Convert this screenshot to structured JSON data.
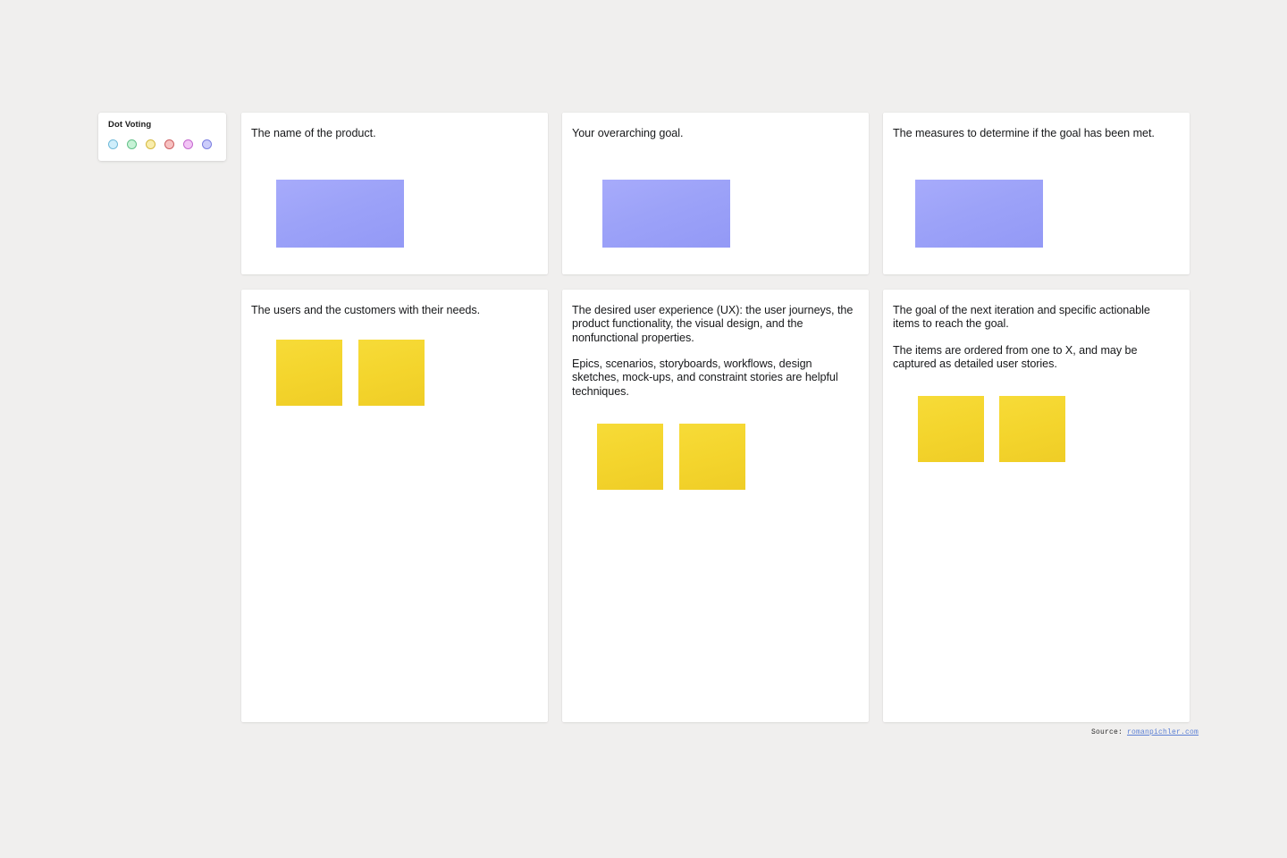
{
  "dot_voting": {
    "title": "Dot Voting",
    "dots": [
      {
        "name": "dot-blue",
        "fill": "#cfeefb",
        "border": "#6fb9d8"
      },
      {
        "name": "dot-green",
        "fill": "#c7f2d6",
        "border": "#63c189"
      },
      {
        "name": "dot-yellow",
        "fill": "#f9edac",
        "border": "#d4b93f"
      },
      {
        "name": "dot-red",
        "fill": "#f7c1c1",
        "border": "#cd5f61"
      },
      {
        "name": "dot-pink",
        "fill": "#f2c4f5",
        "border": "#c468cf"
      },
      {
        "name": "dot-purple",
        "fill": "#cbccfa",
        "border": "#7b7ee0"
      }
    ]
  },
  "cards": [
    {
      "id": "product-name",
      "heading": "The name of the product.",
      "paragraphs": [],
      "notes": [
        {
          "color": "blue"
        }
      ]
    },
    {
      "id": "overarching-goal",
      "heading": "Your overarching goal.",
      "paragraphs": [],
      "notes": [
        {
          "color": "blue"
        }
      ]
    },
    {
      "id": "success-measures",
      "heading": "The measures to determine if the goal has been met.",
      "paragraphs": [],
      "notes": [
        {
          "color": "blue"
        }
      ]
    },
    {
      "id": "users-and-customers",
      "heading": "The users and the customers with their needs.",
      "paragraphs": [],
      "notes": [
        {
          "color": "yellow"
        },
        {
          "color": "yellow"
        }
      ]
    },
    {
      "id": "user-experience",
      "heading": "The desired user experience (UX): the user journeys, the product functionality, the visual design, and the nonfunctional properties.",
      "paragraphs": [
        "Epics, scenarios, storyboards, workflows, design sketches, mock-ups, and constraint stories are helpful techniques."
      ],
      "notes": [
        {
          "color": "yellow"
        },
        {
          "color": "yellow"
        }
      ]
    },
    {
      "id": "iteration-goal",
      "heading": "The goal of the next iteration and specific actionable items to reach the goal.",
      "paragraphs": [
        "The items are ordered from one to X, and may be captured as detailed user stories."
      ],
      "notes": [
        {
          "color": "yellow"
        },
        {
          "color": "yellow"
        }
      ]
    }
  ],
  "source": {
    "label": "Source:",
    "link_text": "romanpichler.com",
    "link_color": "#5b7fd4"
  }
}
